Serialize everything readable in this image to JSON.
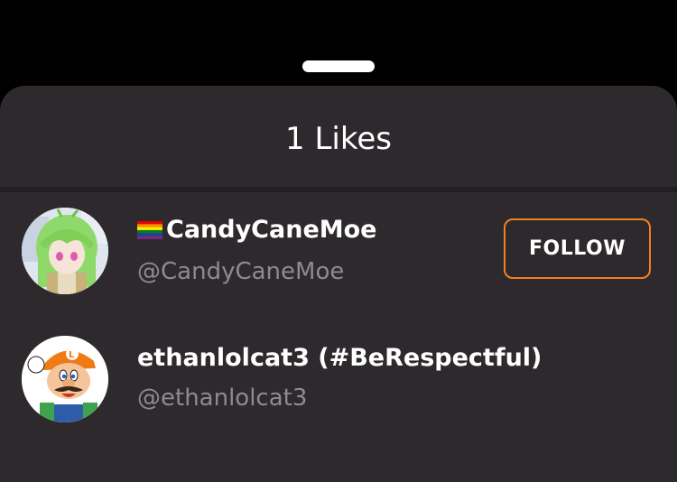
{
  "sheet": {
    "title": "1 Likes"
  },
  "likes": [
    {
      "display_name": "CandyCaneMoe",
      "name_prefix_icon": "rainbow-flag-icon",
      "handle": "@CandyCaneMoe",
      "follow_label": "FOLLOW",
      "avatar": "anime-girl-green-hair-avatar"
    },
    {
      "display_name": "ethanlolcat3 (#BeRespectful)",
      "handle": "@ethanlolcat3",
      "avatar": "plumber-character-avatar"
    }
  ],
  "colors": {
    "sheet_background": "#2d292d",
    "accent": "#f0821e",
    "secondary_text": "#8e8b8f"
  }
}
